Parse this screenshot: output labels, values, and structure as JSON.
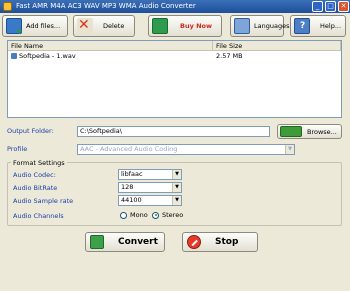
{
  "window": {
    "title": "Fast AMR M4A AC3 WAV MP3 WMA Audio Converter",
    "min": "_",
    "max": "□",
    "close": "✕"
  },
  "toolbar": {
    "add_files": "Add files...",
    "delete": "Delete",
    "buy_now": "Buy Now",
    "languages": "Languages",
    "help": "Help..."
  },
  "file_list": {
    "headers": {
      "name": "File Name",
      "size": "File Size"
    },
    "rows": [
      {
        "name": "Softpedia - 1.wav",
        "size": "2.57 MB"
      }
    ]
  },
  "output": {
    "label": "Output Folder:",
    "value": "C:\\Softpedia\\",
    "browse": "Browse..."
  },
  "profile": {
    "label": "Profile",
    "value": "AAC - Advanced Audio Coding"
  },
  "format_settings": {
    "title": "Format Settings",
    "codec": {
      "label": "Audio Codec:",
      "value": "libfaac"
    },
    "bitrate": {
      "label": "Audio BitRate",
      "value": "128"
    },
    "sample_rate": {
      "label": "Audio Sample rate",
      "value": "44100"
    },
    "channels": {
      "label": "Audio Channels",
      "mono": "Mono",
      "stereo": "Stereo",
      "selected": "Stereo"
    }
  },
  "actions": {
    "convert": "Convert",
    "stop": "Stop"
  },
  "colors": {
    "label_blue": "#1a3fa8",
    "buy_red": "#cc2a1a",
    "title_bar": "#2a5caa"
  }
}
